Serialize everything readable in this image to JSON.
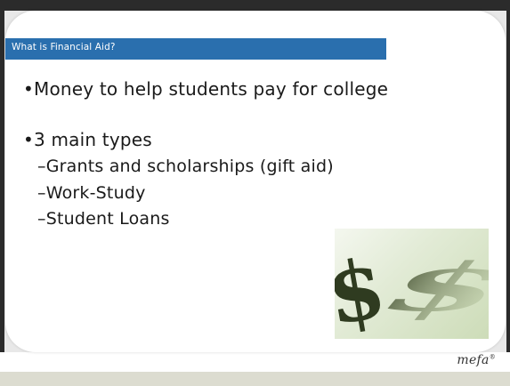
{
  "slide": {
    "title": "What is Financial Aid?",
    "bullets": [
      "•Money to help students pay for college",
      "•3 main types"
    ],
    "sub_bullets": [
      "–Grants and scholarships (gift aid)",
      "–Work-Study",
      "–Student Loans"
    ],
    "image_symbol": "$",
    "logo_text": "mefa",
    "logo_mark": "®"
  },
  "colors": {
    "title_bar": "#2a6fae",
    "dollar_sign": "#2f3b20"
  }
}
